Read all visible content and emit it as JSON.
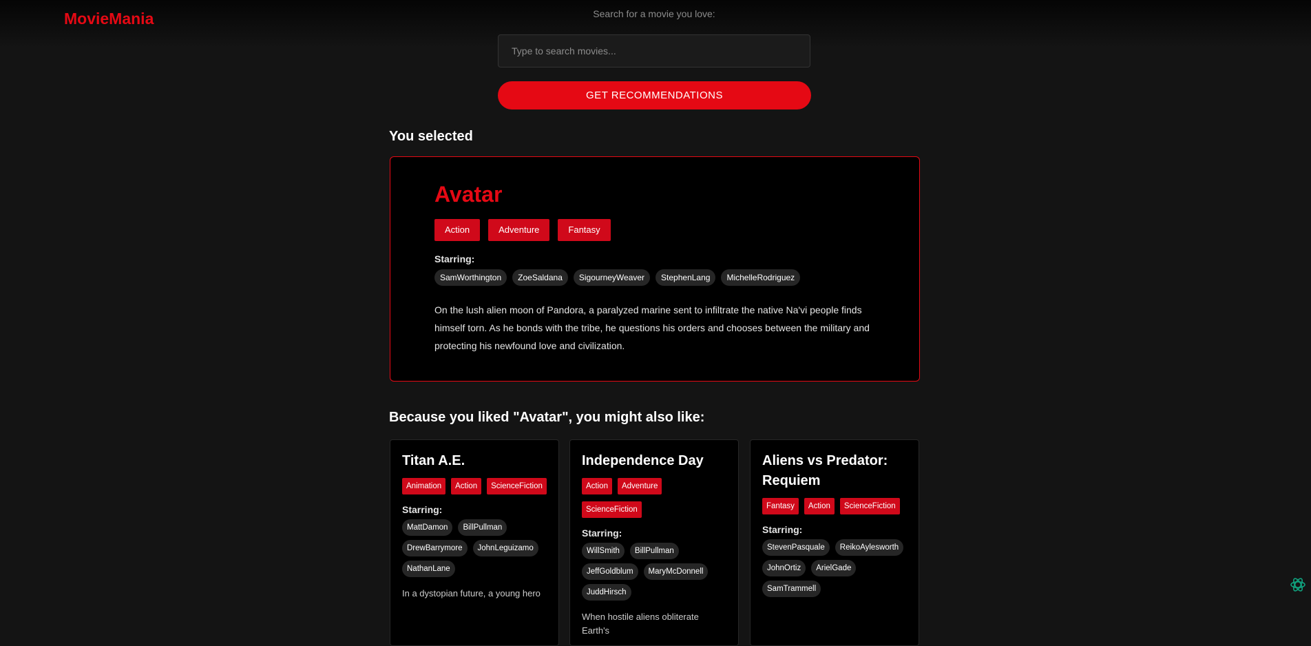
{
  "app": {
    "logo": "MovieMania"
  },
  "search": {
    "label": "Search for a movie you love:",
    "placeholder": "Type to search movies...",
    "value": "",
    "button_label": "GET RECOMMENDATIONS"
  },
  "selected": {
    "heading": "You selected",
    "title": "Avatar",
    "genres": [
      "Action",
      "Adventure",
      "Fantasy"
    ],
    "starring_label": "Starring:",
    "cast": [
      "SamWorthington",
      "ZoeSaldana",
      "SigourneyWeaver",
      "StephenLang",
      "MichelleRodriguez"
    ],
    "overview": "On the lush alien moon of Pandora, a paralyzed marine sent to infiltrate the native Na'vi people finds himself torn. As he bonds with the tribe, he questions his orders and chooses between the military and protecting his newfound love and civilization."
  },
  "recommendations": {
    "heading": "Because you liked \"Avatar\", you might also like:",
    "items": [
      {
        "title": "Titan A.E.",
        "genres": [
          "Animation",
          "Action",
          "ScienceFiction"
        ],
        "starring_label": "Starring:",
        "cast": [
          "MattDamon",
          "BillPullman",
          "DrewBarrymore",
          "JohnLeguizamo",
          "NathanLane"
        ],
        "overview_visible": "In a dystopian future, a young hero"
      },
      {
        "title": "Independence Day",
        "genres": [
          "Action",
          "Adventure",
          "ScienceFiction"
        ],
        "starring_label": "Starring:",
        "cast": [
          "WillSmith",
          "BillPullman",
          "JeffGoldblum",
          "MaryMcDonnell",
          "JuddHirsch"
        ],
        "overview_visible": "When hostile aliens obliterate Earth's"
      },
      {
        "title": "Aliens vs Predator: Requiem",
        "genres": [
          "Fantasy",
          "Action",
          "ScienceFiction"
        ],
        "starring_label": "Starring:",
        "cast": [
          "StevenPasquale",
          "ReikoAylesworth",
          "JohnOrtiz",
          "ArielGade",
          "SamTrammell"
        ],
        "overview_visible": ""
      }
    ]
  },
  "colors": {
    "accent": "#e50914",
    "background": "#141414",
    "card": "#000000",
    "chip": "#262626",
    "assistant_icon": "#10a37f"
  },
  "icons": {
    "assistant": "openai-assistant-icon"
  }
}
